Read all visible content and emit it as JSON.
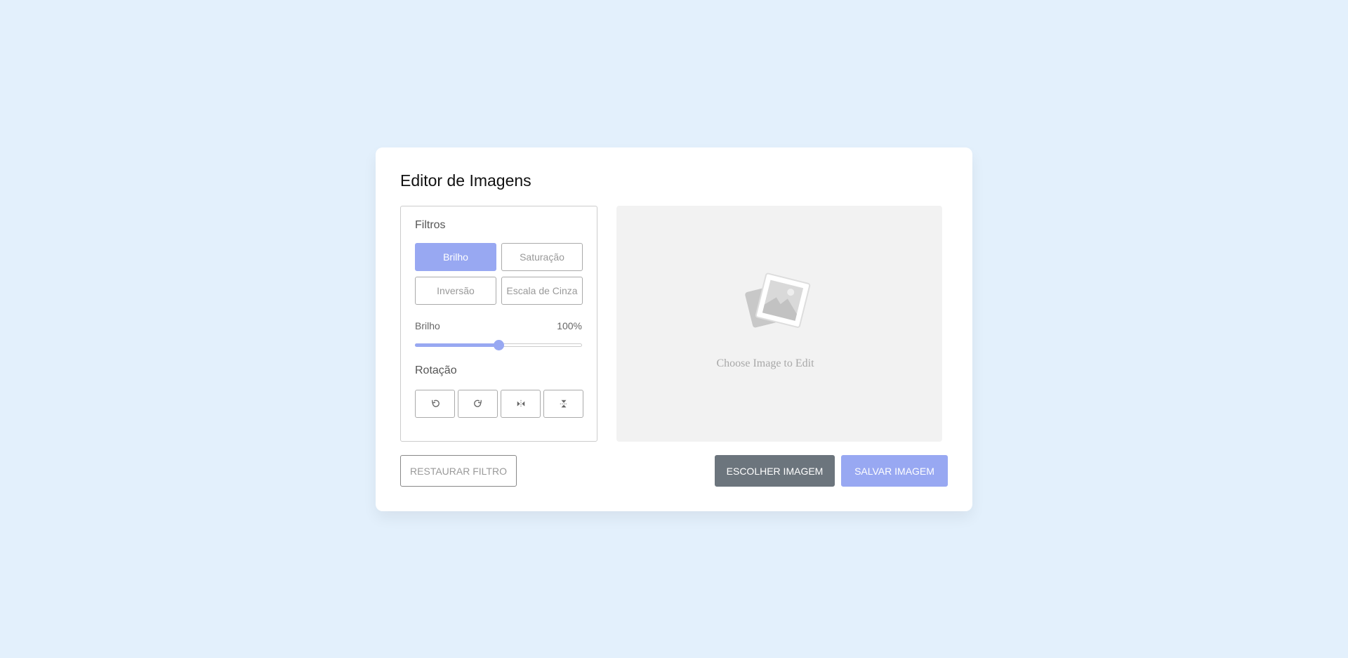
{
  "title": "Editor de Imagens",
  "filters": {
    "label": "Filtros",
    "buttons": [
      {
        "label": "Brilho",
        "active": true
      },
      {
        "label": "Saturação",
        "active": false
      },
      {
        "label": "Inversão",
        "active": false
      },
      {
        "label": "Escala de Cinza",
        "active": false
      }
    ],
    "slider": {
      "name": "Brilho",
      "value": "100%",
      "fraction": 0.5
    }
  },
  "rotation": {
    "label": "Rotação",
    "buttons": [
      {
        "icon": "rotate-left-icon"
      },
      {
        "icon": "rotate-right-icon"
      },
      {
        "icon": "flip-horizontal-icon"
      },
      {
        "icon": "flip-vertical-icon"
      }
    ]
  },
  "preview": {
    "placeholder_text": "Choose Image to Edit",
    "icon": "image-placeholder-icon"
  },
  "actions": {
    "reset_label": "RESTAURAR FILTRO",
    "choose_label": "ESCOLHER IMAGEM",
    "save_label": "SALVAR IMAGEM"
  },
  "colors": {
    "background": "#e3f0fc",
    "accent": "#98a8f2",
    "secondary": "#6c757d"
  }
}
